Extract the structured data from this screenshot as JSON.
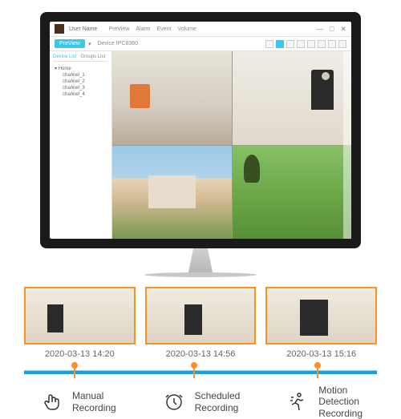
{
  "app": {
    "username": "User Name",
    "menu": [
      "PreView",
      "Alarm",
      "Event",
      "Volume"
    ],
    "device": "Device IPC8360",
    "preview_btn": "PreView"
  },
  "sidebar": {
    "tabs": [
      "Device List",
      "Groups List"
    ],
    "root": "Home",
    "channels": [
      "channel_1",
      "channel_2",
      "channel_3",
      "channel_4"
    ]
  },
  "timeline": {
    "events": [
      {
        "ts": "2020-03-13 14:20"
      },
      {
        "ts": "2020-03-13 14:56"
      },
      {
        "ts": "2020-03-13 15:16"
      }
    ]
  },
  "features": [
    {
      "l1": "Manual",
      "l2": "Recording"
    },
    {
      "l1": "Scheduled",
      "l2": "Recording"
    },
    {
      "l1": "Motion",
      "l2": "Detection",
      "l3": "Recording"
    }
  ]
}
